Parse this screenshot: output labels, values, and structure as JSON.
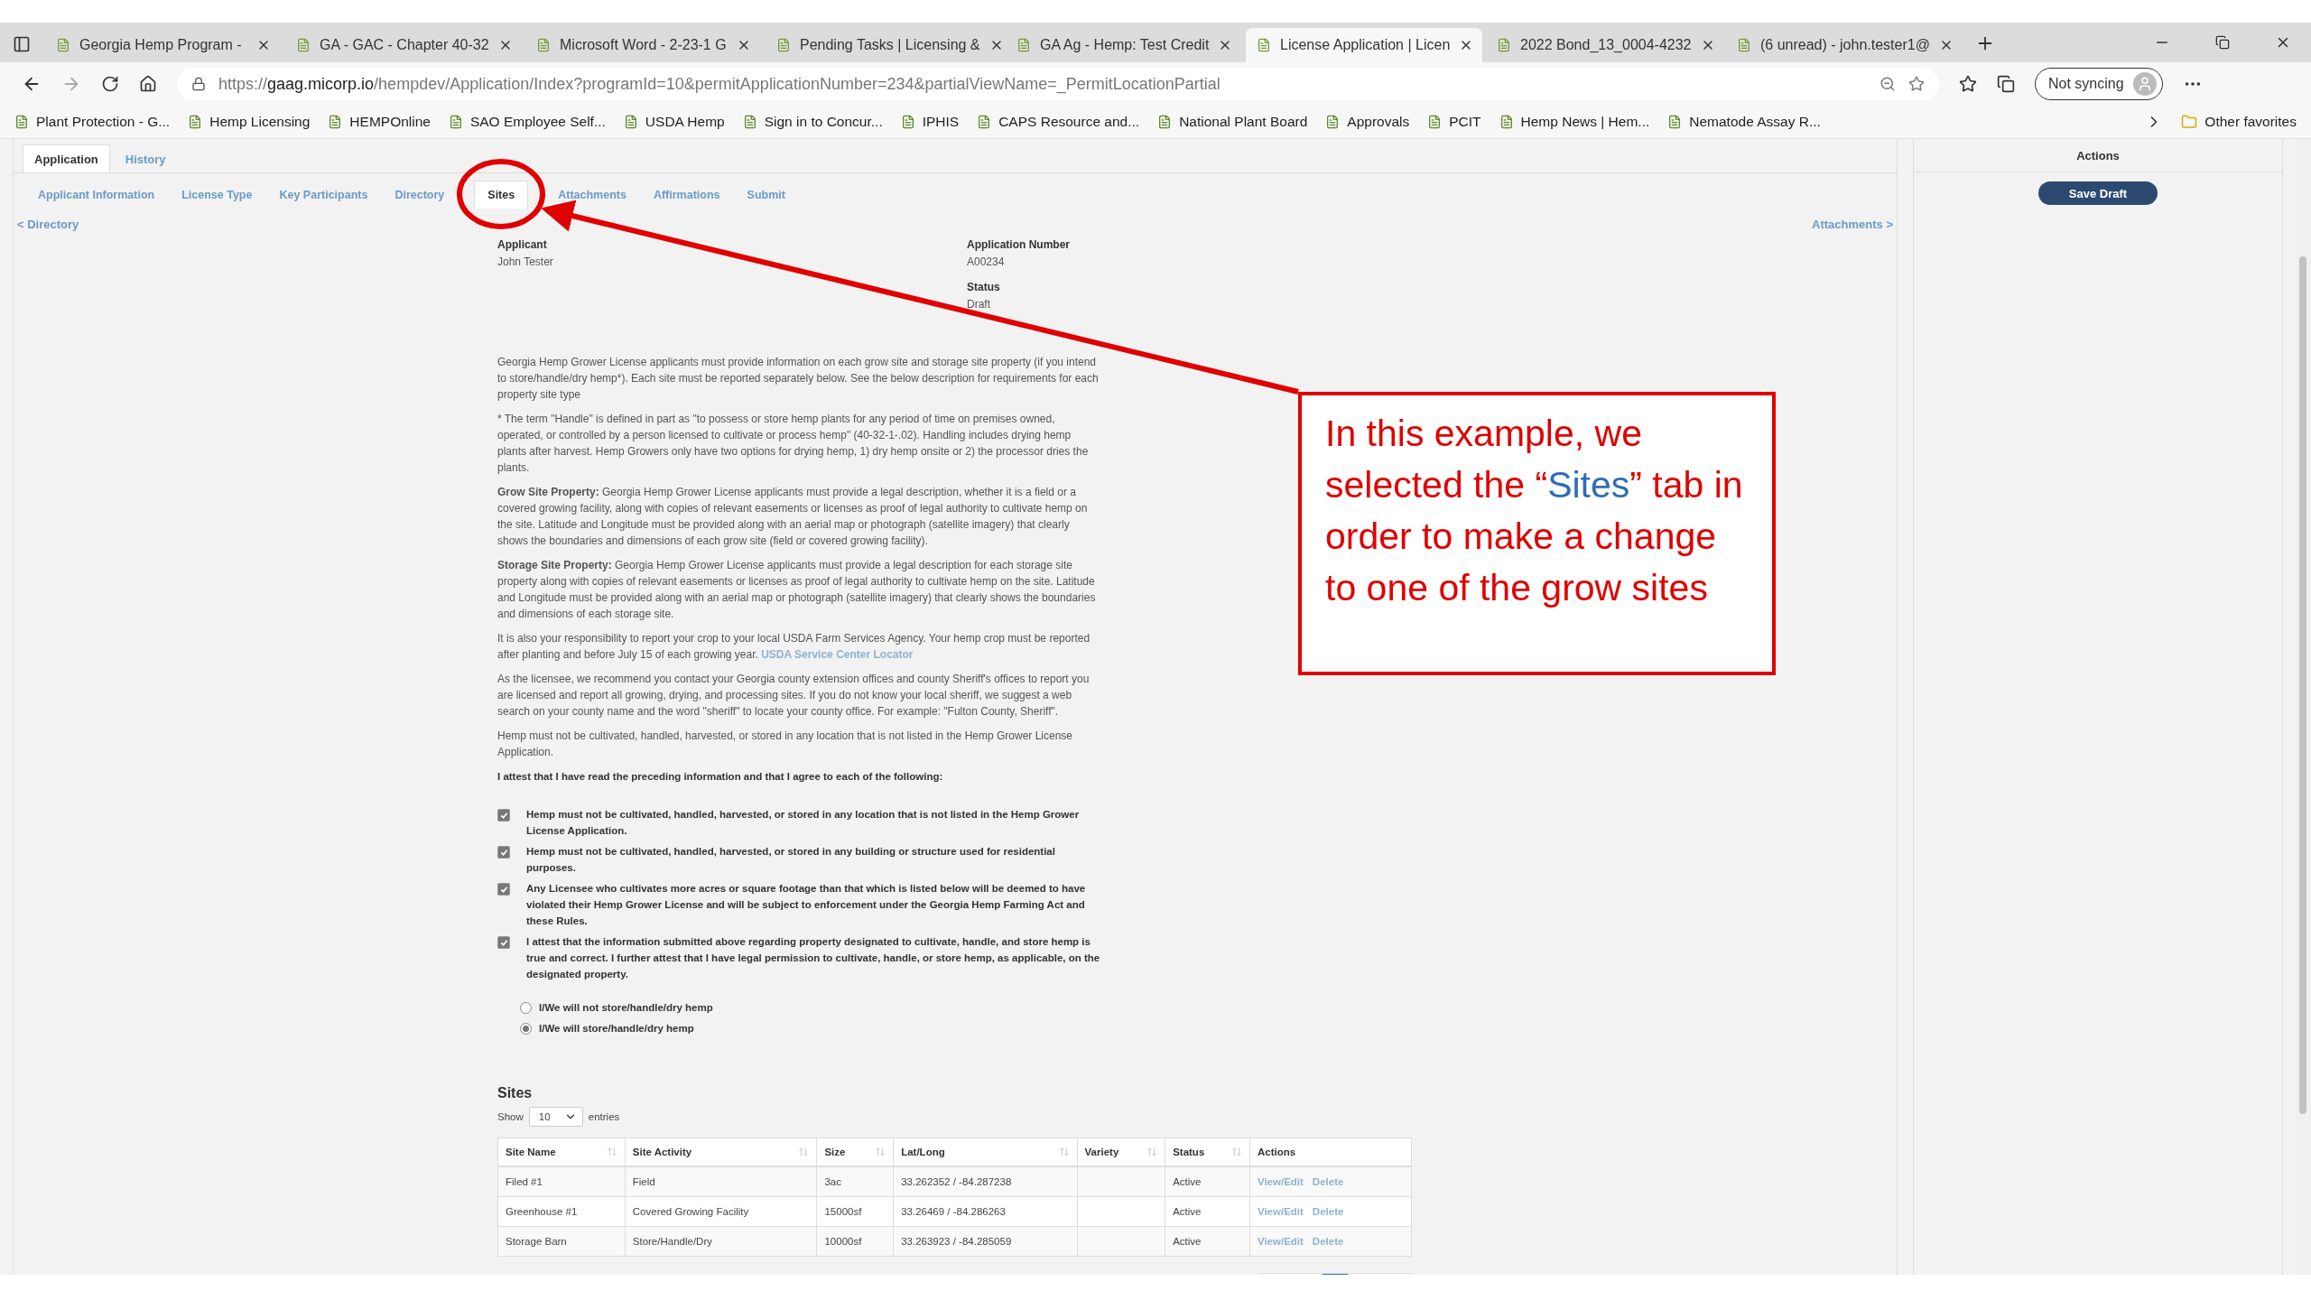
{
  "browser": {
    "tabs": [
      {
        "title": "Georgia Hemp Program -",
        "selected": false
      },
      {
        "title": "GA - GAC - Chapter 40-32",
        "selected": false
      },
      {
        "title": "Microsoft Word - 2-23-1 G",
        "selected": false
      },
      {
        "title": "Pending Tasks | Licensing &",
        "selected": false
      },
      {
        "title": "GA Ag - Hemp: Test Credit",
        "selected": false
      },
      {
        "title": "License Application | Licen",
        "selected": true
      },
      {
        "title": "2022 Bond_13_0004-4232",
        "selected": false
      },
      {
        "title": "(6 unread) - john.tester1@",
        "selected": false
      }
    ],
    "url": {
      "scheme": "https://",
      "domain": "gaag.micorp.io",
      "path": "/hempdev/Application/Index?programId=10&permitApplicationNumber=234&partialViewName=_PermitLocationPartial"
    },
    "sync_button": "Not syncing",
    "bookmarks": [
      "Plant Protection - G...",
      "Hemp Licensing",
      "HEMPOnline",
      "SAO Employee Self...",
      "USDA Hemp",
      "Sign in to Concur...",
      "IPHIS",
      "CAPS Resource and...",
      "National Plant Board",
      "Approvals",
      "PCIT",
      "Hemp News | Hem...",
      "Nematode Assay R..."
    ],
    "other_favorites": "Other favorites"
  },
  "app": {
    "top_tabs": [
      {
        "label": "Application",
        "selected": true
      },
      {
        "label": "History",
        "selected": false
      }
    ],
    "sub_tabs": [
      {
        "label": "Applicant Information",
        "selected": false
      },
      {
        "label": "License Type",
        "selected": false
      },
      {
        "label": "Key Participants",
        "selected": false
      },
      {
        "label": "Directory",
        "selected": false
      },
      {
        "label": "Sites",
        "selected": true
      },
      {
        "label": "Attachments",
        "selected": false
      },
      {
        "label": "Affirmations",
        "selected": false
      },
      {
        "label": "Submit",
        "selected": false
      }
    ],
    "prev_link": "< Directory",
    "next_link": "Attachments >",
    "info": [
      {
        "label": "Applicant",
        "value": "John Tester"
      },
      {
        "label": "Application Number",
        "value": "A00234"
      },
      {
        "label": "Status",
        "value": "Draft"
      }
    ],
    "paragraphs": [
      {
        "text": "Georgia Hemp Grower License applicants must provide information on each grow site and storage site property (if you intend to store/handle/dry hemp*). Each site must be reported separately below. See the below description for requirements for each property site type"
      },
      {
        "text": "* The term \"Handle\" is defined in part as \"to possess or store hemp plants for any period of time on premises owned, operated, or controlled by a person licensed to cultivate or process hemp\" (40-32-1-.02). Handling includes drying hemp plants after harvest. Hemp Growers only have two options for drying hemp, 1) dry hemp onsite or 2) the processor dries the plants."
      },
      {
        "text": "**Grow Site Property:** Georgia Hemp Grower License applicants must provide a legal description, whether it is a field or a covered growing facility, along with copies of relevant easements or licenses as proof of legal authority to cultivate hemp on the site. Latitude and Longitude must be provided along with an aerial map or photograph (satellite imagery) that clearly shows the boundaries and dimensions of each grow site (field or covered growing facility)."
      },
      {
        "text": "**Storage Site Property:** Georgia Hemp Grower License applicants must provide a legal description for each storage site property along with copies of relevant easements or licenses as proof of legal authority to cultivate hemp on the site. Latitude and Longitude must be provided along with an aerial map or photograph (satellite imagery) that clearly shows the boundaries and dimensions of each storage site."
      },
      {
        "text": "It is also your responsibility to report your crop to your local USDA Farm Services Agency. Your hemp crop must be reported after planting and before July 15 of each growing year.",
        "link": "USDA Service Center Locator"
      },
      {
        "text": "As the licensee, we recommend you contact your Georgia county extension offices and county Sheriff's offices to report you are licensed and report all growing, drying, and processing sites. If you do not know your local sheriff, we suggest a web search on your county name and the word \"sheriff\" to locate your county office. For example: \"Fulton County, Sheriff\"."
      },
      {
        "text": "Hemp must not be cultivated, handled, harvested, or stored in any location that is not listed in the Hemp Grower License Application."
      }
    ],
    "attest": "I attest that I have read the preceding information and that I agree to each of the following:",
    "checkboxes": [
      {
        "label": "Hemp must not be cultivated, handled, harvested, or stored in any location that is not listed in the Hemp Grower License Application.",
        "checked": true
      },
      {
        "label": "Hemp must not be cultivated, handled, harvested, or stored in any building or structure used for residential purposes.",
        "checked": true
      },
      {
        "label": "Any Licensee who cultivates more acres or square footage than that which is listed below will be deemed to have violated their Hemp Grower License and will be subject to enforcement under the Georgia Hemp Farming Act and these Rules.",
        "checked": true
      },
      {
        "label": "I attest that the information submitted above regarding property designated to cultivate, handle, and store hemp is true and correct. I further attest that I have legal permission to cultivate, handle, or store hemp, as applicable, on the designated property.",
        "checked": true
      }
    ],
    "radios": [
      {
        "label": "I/We will not store/handle/dry hemp",
        "selected": false
      },
      {
        "label": "I/We will store/handle/dry hemp",
        "selected": true
      }
    ],
    "sites": {
      "title": "Sites",
      "show_label": "Show",
      "page_size": "10",
      "entries_label": "entries",
      "columns": [
        "Site Name",
        "Site Activity",
        "Size",
        "Lat/Long",
        "Variety",
        "Status",
        "Actions"
      ],
      "rows": [
        {
          "cells": [
            "Filed #1",
            "Field",
            "3ac",
            "33.262352 / -84.287238",
            "",
            "Active"
          ],
          "actions": [
            "View/Edit",
            "Delete"
          ]
        },
        {
          "cells": [
            "Greenhouse #1",
            "Covered Growing Facility",
            "15000sf",
            "33.26469 / -84.286263",
            "",
            "Active"
          ],
          "actions": [
            "View/Edit",
            "Delete"
          ]
        },
        {
          "cells": [
            "Storage Barn",
            "Store/Handle/Dry",
            "10000sf",
            "33.263923 / -84.285059",
            "",
            "Active"
          ],
          "actions": [
            "View/Edit",
            "Delete"
          ]
        }
      ],
      "pagination": [
        {
          "selected": false
        },
        {
          "selected": true
        },
        {
          "selected": false
        }
      ]
    }
  },
  "actions_panel": {
    "title": "Actions",
    "save_button": "Save Draft"
  },
  "callout": {
    "before": "In this example, we selected the “",
    "highlight": "Sites",
    "after": "” tab in order to make a change to one of the grow sites"
  }
}
